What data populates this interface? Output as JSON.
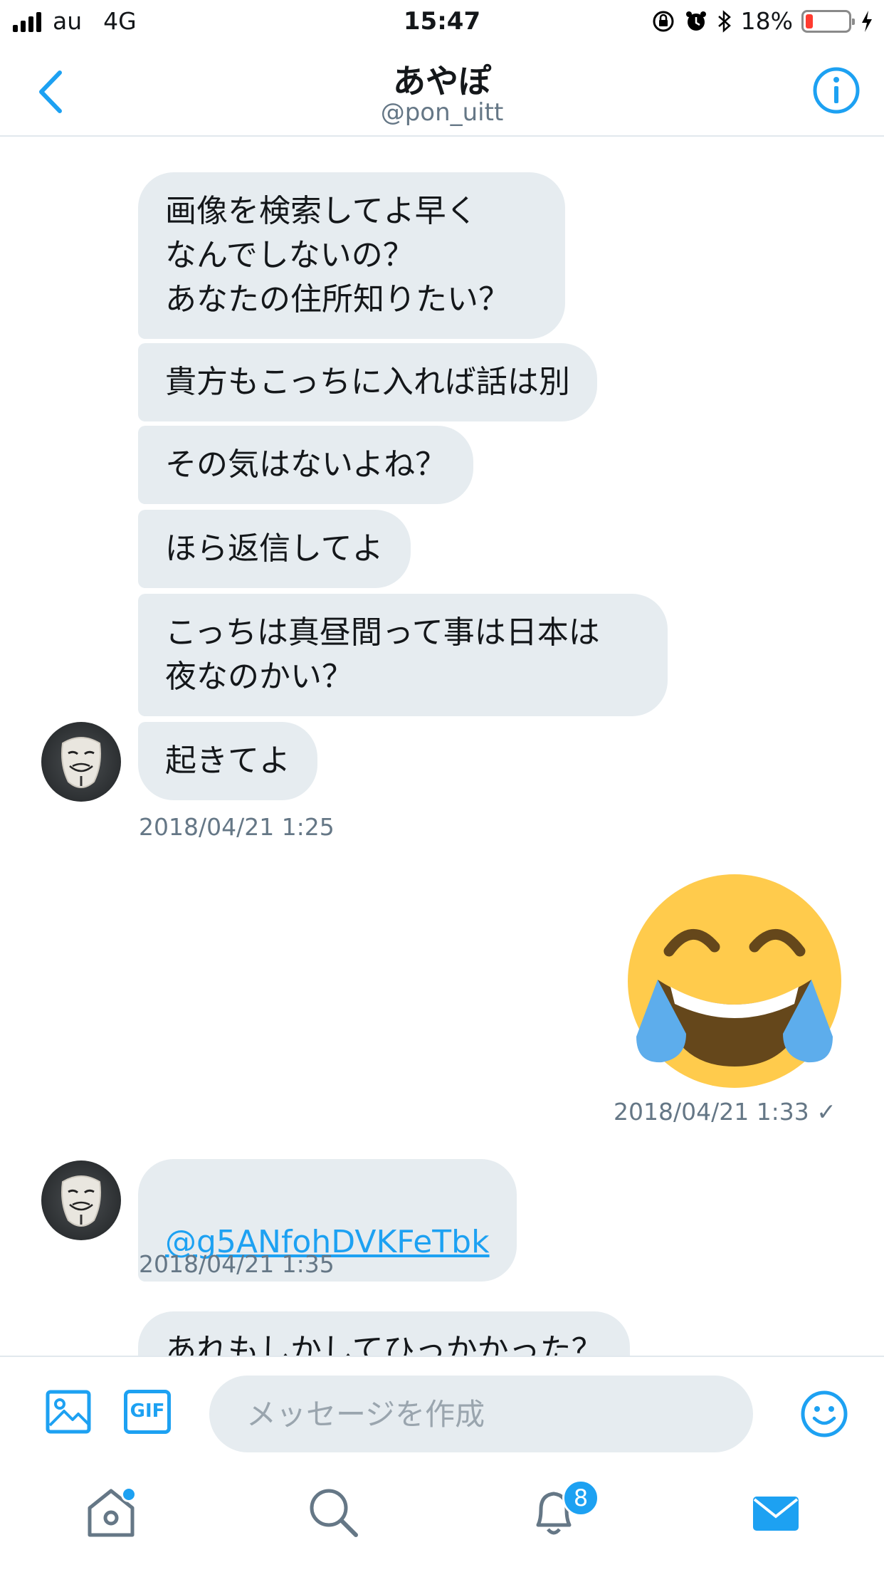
{
  "status_bar": {
    "carrier": "au",
    "network": "4G",
    "time": "15:47",
    "battery_text": "18%",
    "battery_level": 0.18,
    "icons": [
      "signal-icon",
      "orientation-lock-icon",
      "alarm-icon",
      "bluetooth-icon",
      "battery-icon",
      "charging-icon"
    ]
  },
  "header": {
    "name": "あやぽ",
    "handle": "@pon_uitt",
    "accent": "#1da1f2"
  },
  "messages": [
    {
      "text": "画像を検索してよ早く\nなんでしないの？\nあなたの住所知りたい？"
    },
    {
      "text": "貴方もこっちに入れば話は別"
    },
    {
      "text": "その気はないよね？"
    },
    {
      "text": "ほら返信してよ"
    },
    {
      "text": "こっちは真昼間って事は日本は\n夜なのかい？"
    },
    {
      "text": "起きてよ"
    },
    {
      "text": "@g5ANfohDVKFeTbk"
    },
    {
      "text": "あれもしかしてひっかかった？"
    }
  ],
  "timestamps": {
    "t1": "2018/04/21 1:25",
    "t2": "2018/04/21 1:33 ✓",
    "t3": "2018/04/21 1:35"
  },
  "sent_emoji": "face-with-tears-of-joy",
  "composer": {
    "placeholder": "メッセージを作成",
    "gif_label": "GIF"
  },
  "tabbar": {
    "notifications_badge": "8",
    "tabs": [
      "home-icon",
      "search-icon",
      "notifications-icon",
      "messages-icon"
    ]
  }
}
